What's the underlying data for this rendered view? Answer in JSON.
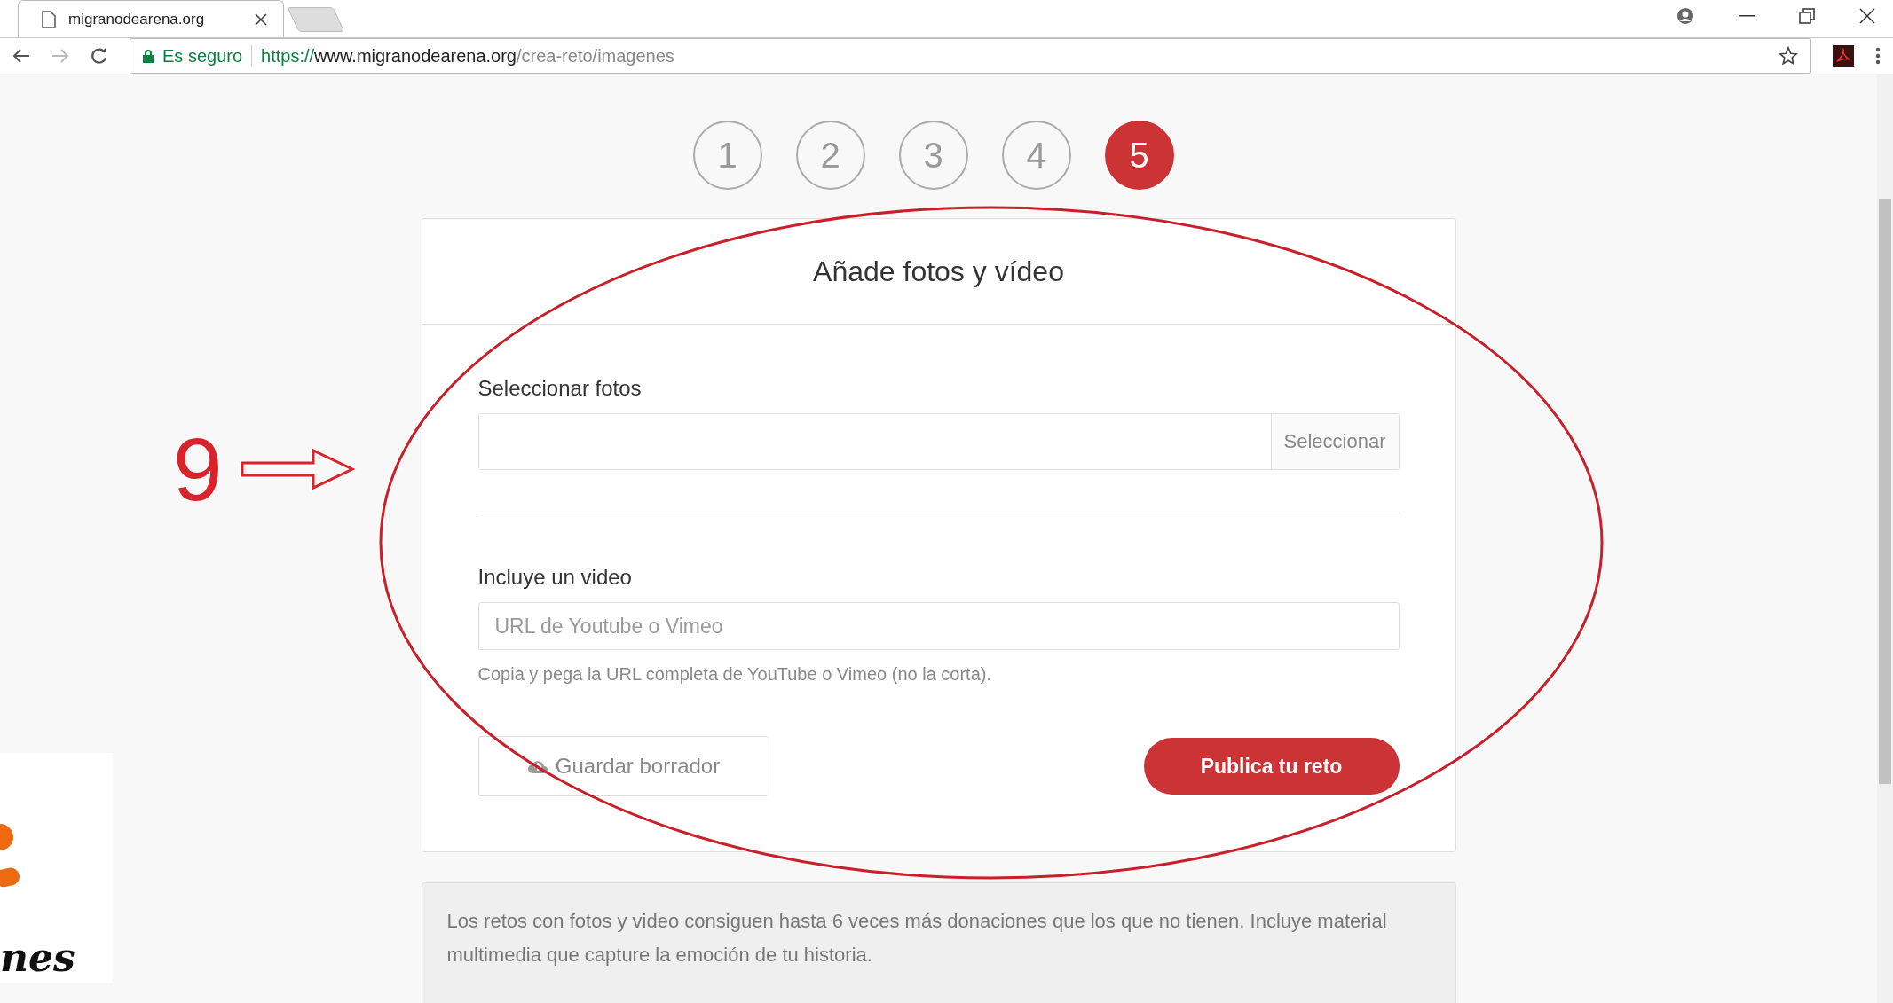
{
  "browser": {
    "tab_title": "migranodearena.org",
    "secure_label": "Es seguro",
    "url": {
      "scheme": "https://",
      "host": "www.migranodearena.org",
      "path": "/crea-reto/imagenes"
    }
  },
  "steps": [
    {
      "label": "1",
      "selected": false
    },
    {
      "label": "2",
      "selected": false
    },
    {
      "label": "3",
      "selected": false
    },
    {
      "label": "4",
      "selected": false
    },
    {
      "label": "5",
      "selected": true
    }
  ],
  "card": {
    "title": "Añade fotos y vídeo",
    "photos": {
      "label": "Seleccionar fotos",
      "button": "Seleccionar"
    },
    "video": {
      "label": "Incluye un video",
      "placeholder": "URL de Youtube o Vimeo",
      "help": "Copia y pega la URL completa de YouTube o Vimeo (no la corta)."
    },
    "draft_button": "Guardar borrador",
    "publish_button": "Publica tu reto"
  },
  "info": "Los retos con fotos y video consiguen hasta 6 veces más donaciones que los que no tienen. Incluye material multimedia que capture la emoción de tu historia.",
  "annotation": {
    "number": "9"
  },
  "logo": {
    "text": "nes"
  }
}
